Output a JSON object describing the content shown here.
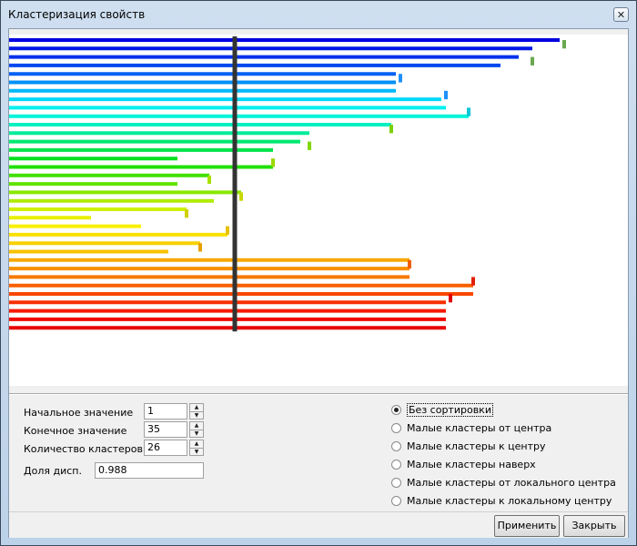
{
  "window": {
    "title": "Кластеризация свойств",
    "close_glyph": "✕"
  },
  "params": {
    "start_label": "Начальное значение",
    "start_value": "1",
    "end_label": "Конечное значение",
    "end_value": "35",
    "clusters_label": "Количество кластеров",
    "clusters_value": "26",
    "share_label": "Доля дисп.",
    "share_value": "0.988"
  },
  "sorting": {
    "options": [
      {
        "label": "Без сортировки",
        "selected": true
      },
      {
        "label": "Малые кластеры от центра",
        "selected": false
      },
      {
        "label": "Малые кластеры к центру",
        "selected": false
      },
      {
        "label": "Малые кластеры наверх",
        "selected": false
      },
      {
        "label": "Малые кластеры от локального центра",
        "selected": false
      },
      {
        "label": "Малые кластеры к локальному центру",
        "selected": false
      }
    ]
  },
  "buttons": {
    "apply": "Применить",
    "close": "Закрыть"
  },
  "chart_data": {
    "type": "dendrogram",
    "leaves": 35,
    "leaf_colors": [
      "#0000e0",
      "#0018e6",
      "#0030ec",
      "#0048f0",
      "#0060f4",
      "#0090f8",
      "#00b8fa",
      "#00d8fc",
      "#00f0f0",
      "#00f4d8",
      "#00f0c0",
      "#00ec98",
      "#00e870",
      "#00e448",
      "#00e020",
      "#20e000",
      "#40e000",
      "#60e400",
      "#88e800",
      "#b0ec00",
      "#d0f000",
      "#e8f000",
      "#f8f000",
      "#f8e000",
      "#f8d000",
      "#f8c000",
      "#f8a800",
      "#f89000",
      "#f87800",
      "#f86000",
      "#f84800",
      "#f83000",
      "#f81800",
      "#f00800",
      "#e80000"
    ],
    "cut_line_color": "#333333",
    "cluster_count": 26
  }
}
